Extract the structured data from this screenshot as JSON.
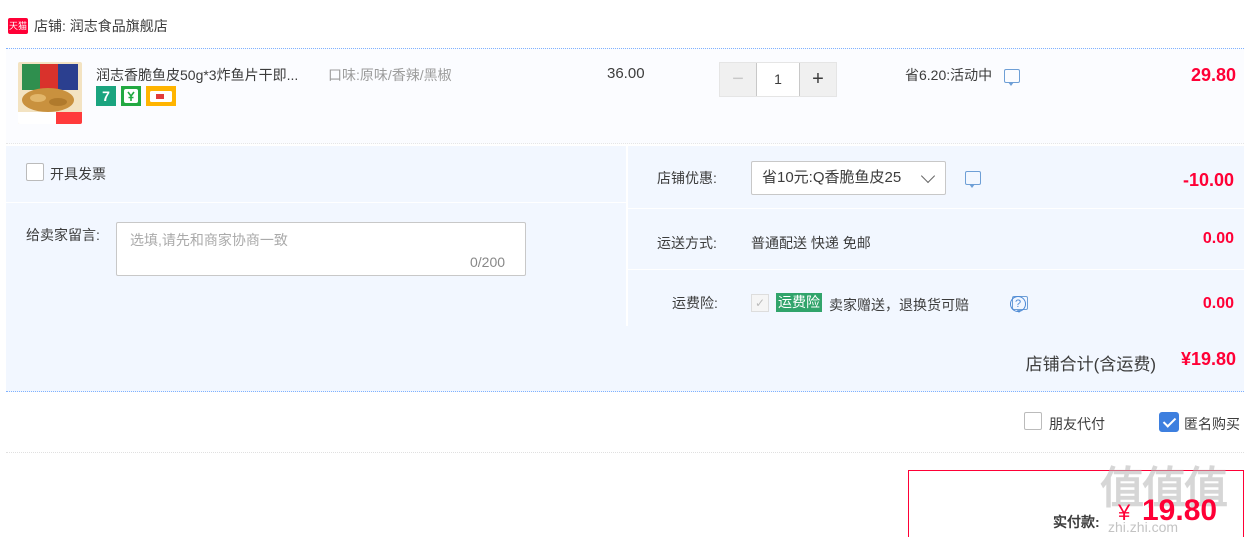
{
  "shop": {
    "badge": "天猫",
    "name": "店铺: 润志食品旗舰店"
  },
  "item": {
    "title": "润志香脆鱼皮50g*3炸鱼片干即...",
    "spec": "口味:原味/香辣/黑椒",
    "service_icons": [
      "seven-day-return-icon",
      "wechat-pay-icon",
      "credit-card-icon"
    ],
    "service_7": "7",
    "unit_price": "36.00",
    "quantity": "1",
    "minus": "−",
    "plus": "+",
    "discount": "省6.20:活动中",
    "total": "29.80"
  },
  "options": {
    "invoice_label": "开具发票",
    "memo_label": "给卖家留言:",
    "memo_placeholder": "选填,请先和商家协商一致",
    "memo_count": "0/200"
  },
  "summary": {
    "coupon_label": "店铺优惠:",
    "coupon_value": "省10元:Q香脆鱼皮25",
    "coupon_amount": "-10.00",
    "shipping_label": "运送方式:",
    "shipping_value": "普通配送 快递 免邮",
    "shipping_amount": "0.00",
    "insurance_label": "运费险:",
    "insurance_check": "✓",
    "insurance_badge": "运费险",
    "insurance_text": "卖家赠送，退换货可赔",
    "insurance_q": "?",
    "insurance_amount": "0.00",
    "total_label": "店铺合计(含运费)",
    "total_value": "¥19.80"
  },
  "checkout": {
    "friend_pay": "朋友代付",
    "anonymous": "匿名购买",
    "pay_label": "实付款:",
    "currency": "¥",
    "pay_value": "19.80"
  },
  "watermark": {
    "text": "值值值",
    "url": "zhi.zhi.com"
  },
  "colors": {
    "accent": "#ff0036",
    "blue": "#3d7fdf",
    "panel": "#f2f7ff"
  }
}
